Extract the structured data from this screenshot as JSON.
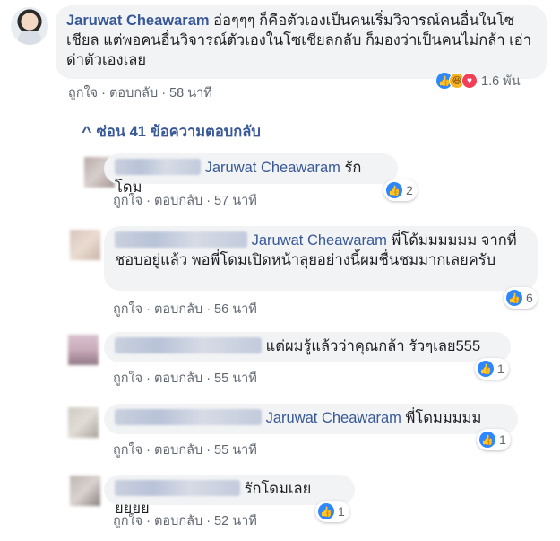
{
  "main_comment": {
    "author": "Jaruwat Cheawaram",
    "text": "อ่อๆๆๆ ก็คือตัวเองเป็นคนเริ่มวิจารณ์คนอื่นในโซเชียล แต่พอคนอื่นวิจารณ์ตัวเองในโซเชียลกลับ ก็มองว่าเป็นคนไม่กล้า เอ่า ด่าตัวเองเลย",
    "like_label": "ถูกใจ",
    "reply_label": "ตอบกลับ",
    "time": "58 นาที",
    "reaction_count": "1.6 พัน",
    "reaction_icons": [
      "like-icon",
      "haha-icon",
      "love-icon"
    ]
  },
  "hide_replies_label": "ซ่อน 41 ข้อความตอบกลับ",
  "replies": [
    {
      "mention": "Jaruwat Cheawaram",
      "text": "รักโดม",
      "like_label": "ถูกใจ",
      "reply_label": "ตอบกลับ",
      "time": "57 นาที",
      "reaction_count": "2"
    },
    {
      "mention": "Jaruwat Cheawaram",
      "text": "พี่โด้มมมมมม จากที่ชอบอยู่แล้ว พอพี่โดมเปิดหน้าลุยอย่างนี้ผมชื่นชมมากเลยครับ",
      "like_label": "ถูกใจ",
      "reply_label": "ตอบกลับ",
      "time": "56 นาที",
      "reaction_count": "6"
    },
    {
      "text": "แต่ผมรู้แล้วว่าคุณกล้า รัวๆเลย555",
      "like_label": "ถูกใจ",
      "reply_label": "ตอบกลับ",
      "time": "55 นาที",
      "reaction_count": "1"
    },
    {
      "mention": "Jaruwat Cheawaram",
      "text": "พี่โดมมมมม",
      "like_label": "ถูกใจ",
      "reply_label": "ตอบกลับ",
      "time": "55 นาที",
      "reaction_count": "1"
    },
    {
      "text": "รักโดมเลยยยยย",
      "like_label": "ถูกใจ",
      "reply_label": "ตอบกลับ",
      "time": "52 นาที",
      "reaction_count": "1"
    }
  ],
  "colors": {
    "link": "#385898",
    "bubble": "#f2f3f5",
    "meta": "#606770",
    "like": "#2d88ff"
  }
}
